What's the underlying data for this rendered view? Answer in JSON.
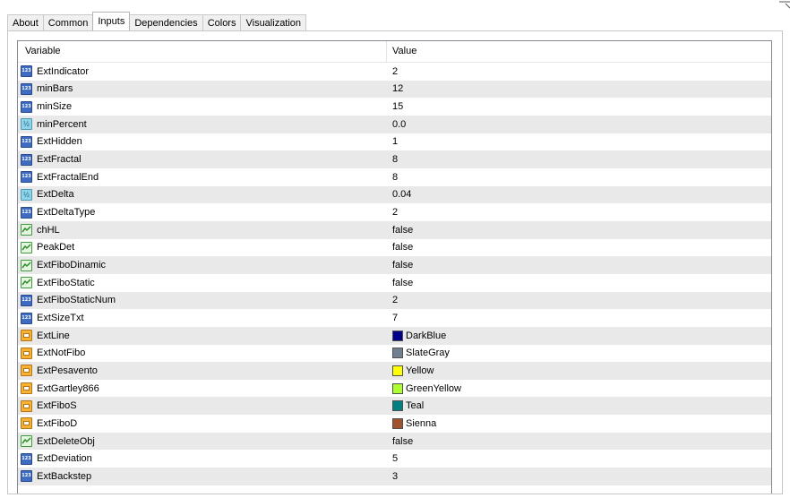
{
  "tabs": [
    "About",
    "Common",
    "Inputs",
    "Dependencies",
    "Colors",
    "Visualization"
  ],
  "active_tab": "Inputs",
  "columns": {
    "variable": "Variable",
    "value": "Value"
  },
  "rows": [
    {
      "name": "ExtIndicator",
      "type": "int",
      "value": "2"
    },
    {
      "name": "minBars",
      "type": "int",
      "value": "12"
    },
    {
      "name": "minSize",
      "type": "int",
      "value": "15"
    },
    {
      "name": "minPercent",
      "type": "double",
      "value": "0.0"
    },
    {
      "name": "ExtHidden",
      "type": "int",
      "value": "1"
    },
    {
      "name": "ExtFractal",
      "type": "int",
      "value": "8"
    },
    {
      "name": "ExtFractalEnd",
      "type": "int",
      "value": "8"
    },
    {
      "name": "ExtDelta",
      "type": "double",
      "value": "0.04"
    },
    {
      "name": "ExtDeltaType",
      "type": "int",
      "value": "2"
    },
    {
      "name": "chHL",
      "type": "bool",
      "value": "false"
    },
    {
      "name": "PeakDet",
      "type": "bool",
      "value": "false"
    },
    {
      "name": "ExtFiboDinamic",
      "type": "bool",
      "value": "false"
    },
    {
      "name": "ExtFiboStatic",
      "type": "bool",
      "value": "false"
    },
    {
      "name": "ExtFiboStaticNum",
      "type": "int",
      "value": "2"
    },
    {
      "name": "ExtSizeTxt",
      "type": "int",
      "value": "7"
    },
    {
      "name": "ExtLine",
      "type": "color",
      "value": "DarkBlue",
      "color": "#00008b"
    },
    {
      "name": "ExtNotFibo",
      "type": "color",
      "value": "SlateGray",
      "color": "#708090"
    },
    {
      "name": "ExtPesavento",
      "type": "color",
      "value": "Yellow",
      "color": "#ffff00"
    },
    {
      "name": "ExtGartley866",
      "type": "color",
      "value": "GreenYellow",
      "color": "#adff2f"
    },
    {
      "name": "ExtFiboS",
      "type": "color",
      "value": "Teal",
      "color": "#008080"
    },
    {
      "name": "ExtFiboD",
      "type": "color",
      "value": "Sienna",
      "color": "#a0522d"
    },
    {
      "name": "ExtDeleteObj",
      "type": "bool",
      "value": "false"
    },
    {
      "name": "ExtDeviation",
      "type": "int",
      "value": "5"
    },
    {
      "name": "ExtBackstep",
      "type": "int",
      "value": "3"
    }
  ]
}
